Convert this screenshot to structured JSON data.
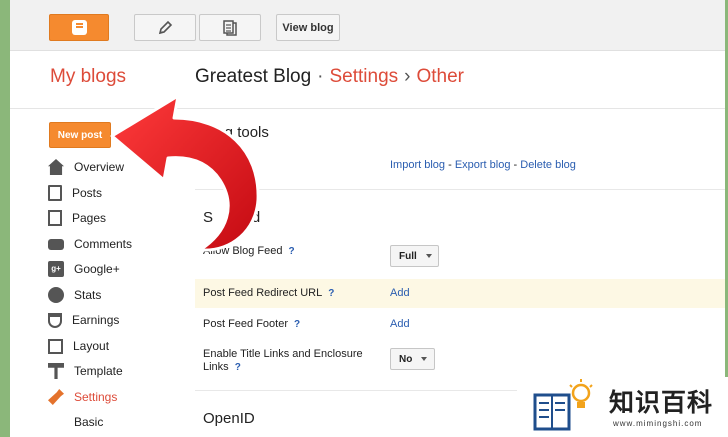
{
  "topbar": {
    "view_blog_label": "View blog"
  },
  "sidebar": {
    "title": "My blogs",
    "new_post_label": "New post",
    "items": [
      {
        "label": "Overview",
        "icon": "home-icon"
      },
      {
        "label": "Posts",
        "icon": "posts-icon"
      },
      {
        "label": "Pages",
        "icon": "pages-icon"
      },
      {
        "label": "Comments",
        "icon": "comments-icon"
      },
      {
        "label": "Google+",
        "icon": "google-plus-icon"
      },
      {
        "label": "Stats",
        "icon": "stats-icon"
      },
      {
        "label": "Earnings",
        "icon": "earnings-icon"
      },
      {
        "label": "Layout",
        "icon": "layout-icon"
      },
      {
        "label": "Template",
        "icon": "template-icon"
      },
      {
        "label": "Settings",
        "icon": "wrench-icon"
      }
    ],
    "sub_items": [
      "Basic"
    ]
  },
  "header": {
    "blog_name": "Greatest Blog",
    "separator_1": "·",
    "crumb_1": "Settings",
    "separator_2": "›",
    "crumb_2": "Other"
  },
  "blog_tools": {
    "title": "Blog tools",
    "row_label": "ols",
    "import": "Import blog",
    "export": "Export blog",
    "delete": "Delete blog",
    "dash": " - "
  },
  "site_feed": {
    "title": "Site feed",
    "title_visible": "S",
    "title_visible_end": "feed",
    "allow_label": "Allow Blog Feed",
    "allow_value": "Full",
    "redirect_label": "Post Feed Redirect URL",
    "redirect_action": "Add",
    "footer_label": "Post Feed Footer",
    "footer_action": "Add",
    "enclosure_label_1": "Enable Title Links and Enclosure",
    "enclosure_label_2": "Links",
    "enclosure_value": "No",
    "help": "?"
  },
  "openid": {
    "title": "OpenID"
  },
  "watermark": {
    "title": "知识百科",
    "url": "www.mimingshi.com"
  },
  "colors": {
    "accent_orange": "#f58a2f",
    "link_red": "#dd4b39",
    "link_blue": "#2a5db0",
    "arrow_red": "#e8141c"
  }
}
